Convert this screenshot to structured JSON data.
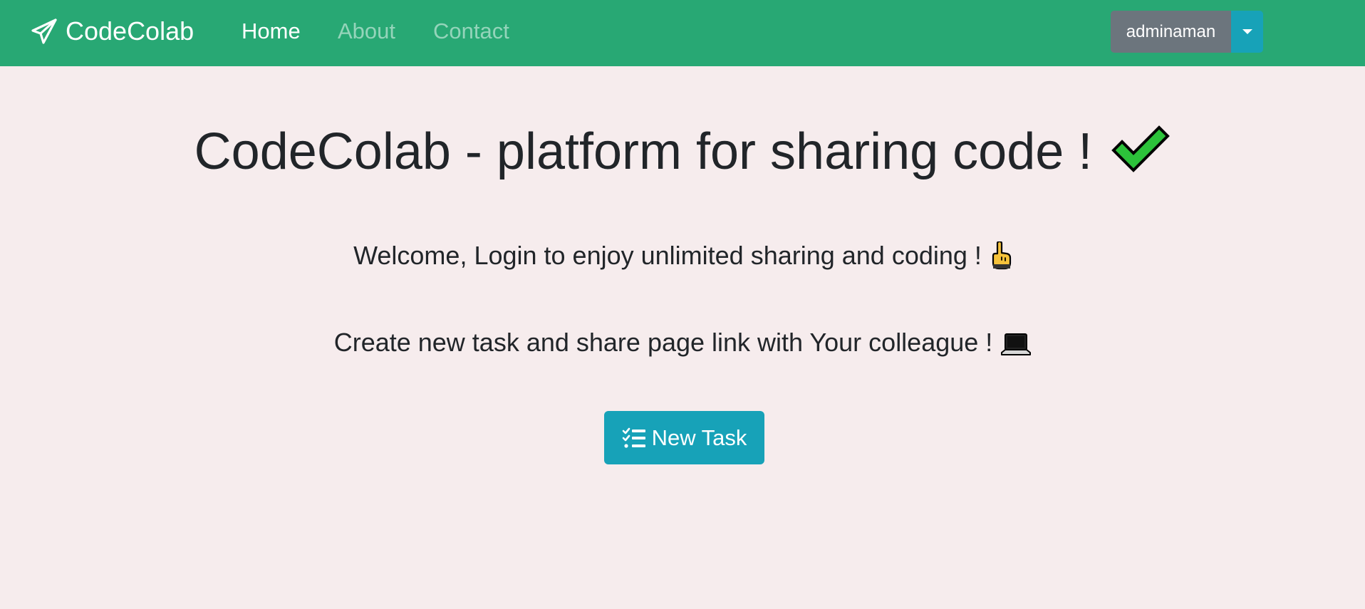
{
  "navbar": {
    "brand": {
      "label": "CodeColab",
      "icon": "paper-plane-icon"
    },
    "links": [
      {
        "label": "Home",
        "active": true
      },
      {
        "label": "About",
        "active": false
      },
      {
        "label": "Contact",
        "active": false
      }
    ],
    "user_menu": {
      "label": "adminaman",
      "toggle_icon": "caret-down-icon"
    }
  },
  "hero": {
    "title": "CodeColab - platform for sharing code !",
    "title_icon": "check-mark-icon",
    "line1": "Welcome, Login to enjoy unlimited sharing and coding !",
    "line1_icon": "pointing-finger-icon",
    "line2": "Create new task and share page link with Your colleague !",
    "line2_icon": "laptop-icon"
  },
  "new_task_button": {
    "label": "New Task",
    "icon": "tasks-icon"
  },
  "colors": {
    "navbar_bg": "#28a874",
    "page_bg": "#f6eced",
    "primary_button": "#17a2b8",
    "secondary_button": "#6c757d",
    "check_green": "#2cc23a"
  }
}
